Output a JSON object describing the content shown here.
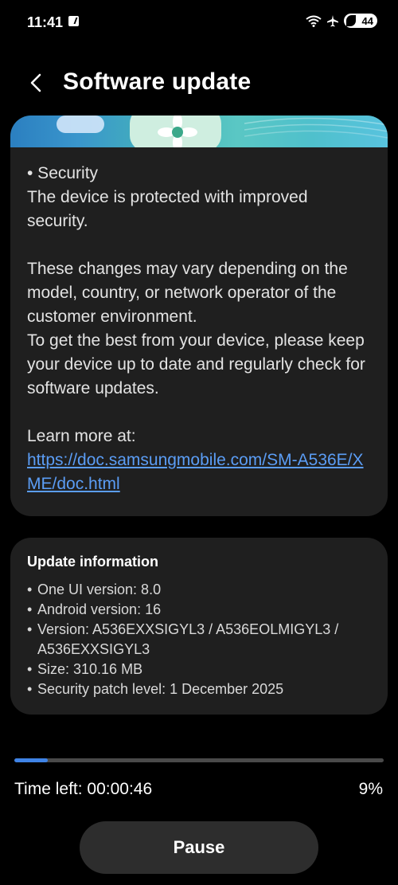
{
  "status_bar": {
    "time": "11:41",
    "battery": "44",
    "icons": [
      "notification-icon",
      "wifi-icon",
      "airplane-mode-icon",
      "battery-icon"
    ]
  },
  "header": {
    "title": "Software update",
    "back_icon": "chevron-left-icon"
  },
  "details": {
    "paragraphs": [
      "• Security",
      "The device is protected with improved security.",
      "These changes may vary depending on the model, country, or network operator of the customer environment.",
      "To get the best from your device, please keep your device up to date and regularly check for software updates.",
      "Learn more at:"
    ],
    "link": "https://doc.samsungmobile.com/SM-A536E/XME/doc.html"
  },
  "update_info": {
    "title": "Update information",
    "items": [
      "One UI version: 8.0",
      "Android version: 16",
      "Version: A536EXXSIGYL3 / A536EOLMIGYL3 / A536EXXSIGYL3",
      "Size: 310.16 MB",
      "Security patch level: 1 December 2025"
    ]
  },
  "progress": {
    "time_left": "Time left: 00:00:46",
    "percent_label": "9%",
    "value": 0.09
  },
  "pause_label": "Pause",
  "colors": {
    "accent": "#3f83e6",
    "link": "#5b9df5",
    "card": "#1f1f1f",
    "background": "#000000"
  }
}
